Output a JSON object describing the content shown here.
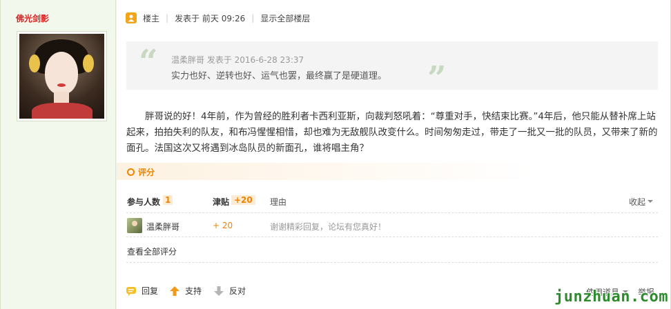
{
  "author": {
    "name": "佛光剑影"
  },
  "post_meta": {
    "op_label": "楼主",
    "posted": "发表于 前天 09:26",
    "show_all_floors": "显示全部楼层"
  },
  "quote": {
    "header": "温柔胖哥 发表于 2016-6-28 23:37",
    "text": "实力也好、逆转也好、运气也罢，最终赢了是硬道理。"
  },
  "body": {
    "text": "胖哥说的好！4年前，作为曾经的胜利者卡西利亚斯，向裁判怒吼着：“尊重对手，快结束比赛。”4年后，他只能从替补席上站起来，拍拍失利的队友，和布冯惺惺相惜，却也难为无敌舰队改变什么。时间匆匆走过，带走了一批又一批的队员，又带来了新的面孔。法国这次又将遇到冰岛队员的新面孔，谁将唱主角？"
  },
  "rating": {
    "title": "评分",
    "col_participants": "参与人数",
    "participants_count": "1",
    "col_allowance": "津贴",
    "allowance_total": "+20",
    "col_reason": "理由",
    "collapse": "收起",
    "rows": [
      {
        "user": "温柔胖哥",
        "points": "+ 20",
        "reason": "谢谢精彩回复，论坛有您真好！"
      }
    ],
    "view_all": "查看全部评分"
  },
  "actions": {
    "reply": "回复",
    "support": "支持",
    "oppose": "反对",
    "tools": "使用道具",
    "report": "举报"
  },
  "watermark": "junzhuan.com",
  "colors": {
    "author_name": "#e02020",
    "accent_orange": "#f08300",
    "watermark_green": "#2e8b2e"
  },
  "icons": [
    "op-user-icon",
    "quote-open-icon",
    "quote-close-icon",
    "rating-circle-icon",
    "chevron-down-icon",
    "reply-bubble-icon",
    "thumb-up-arrow-icon",
    "thumb-down-arrow-icon"
  ]
}
